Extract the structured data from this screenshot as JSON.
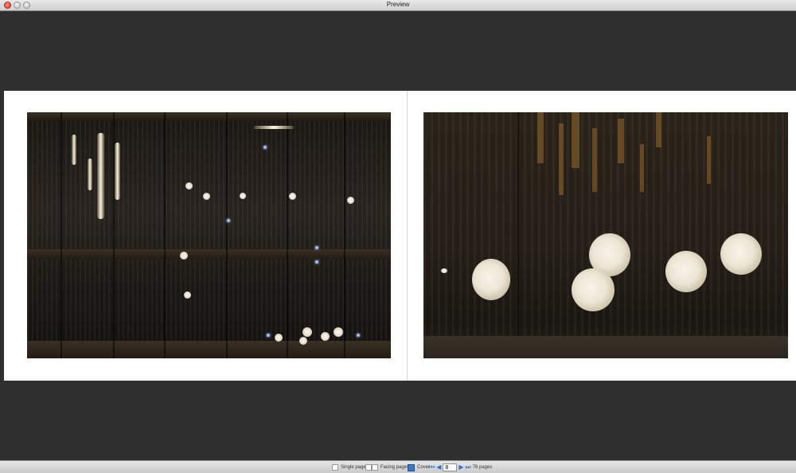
{
  "window": {
    "title": "Preview"
  },
  "toolbar": {
    "single_pages_label": "Single pages",
    "facing_pages_label": "Facing pages",
    "cover_label": "Cover",
    "first_icon": "⏮",
    "prev_icon": "◀",
    "next_icon": "▶",
    "last_icon": "⏭",
    "page_value": "8",
    "page_count_label": "76 pages"
  }
}
